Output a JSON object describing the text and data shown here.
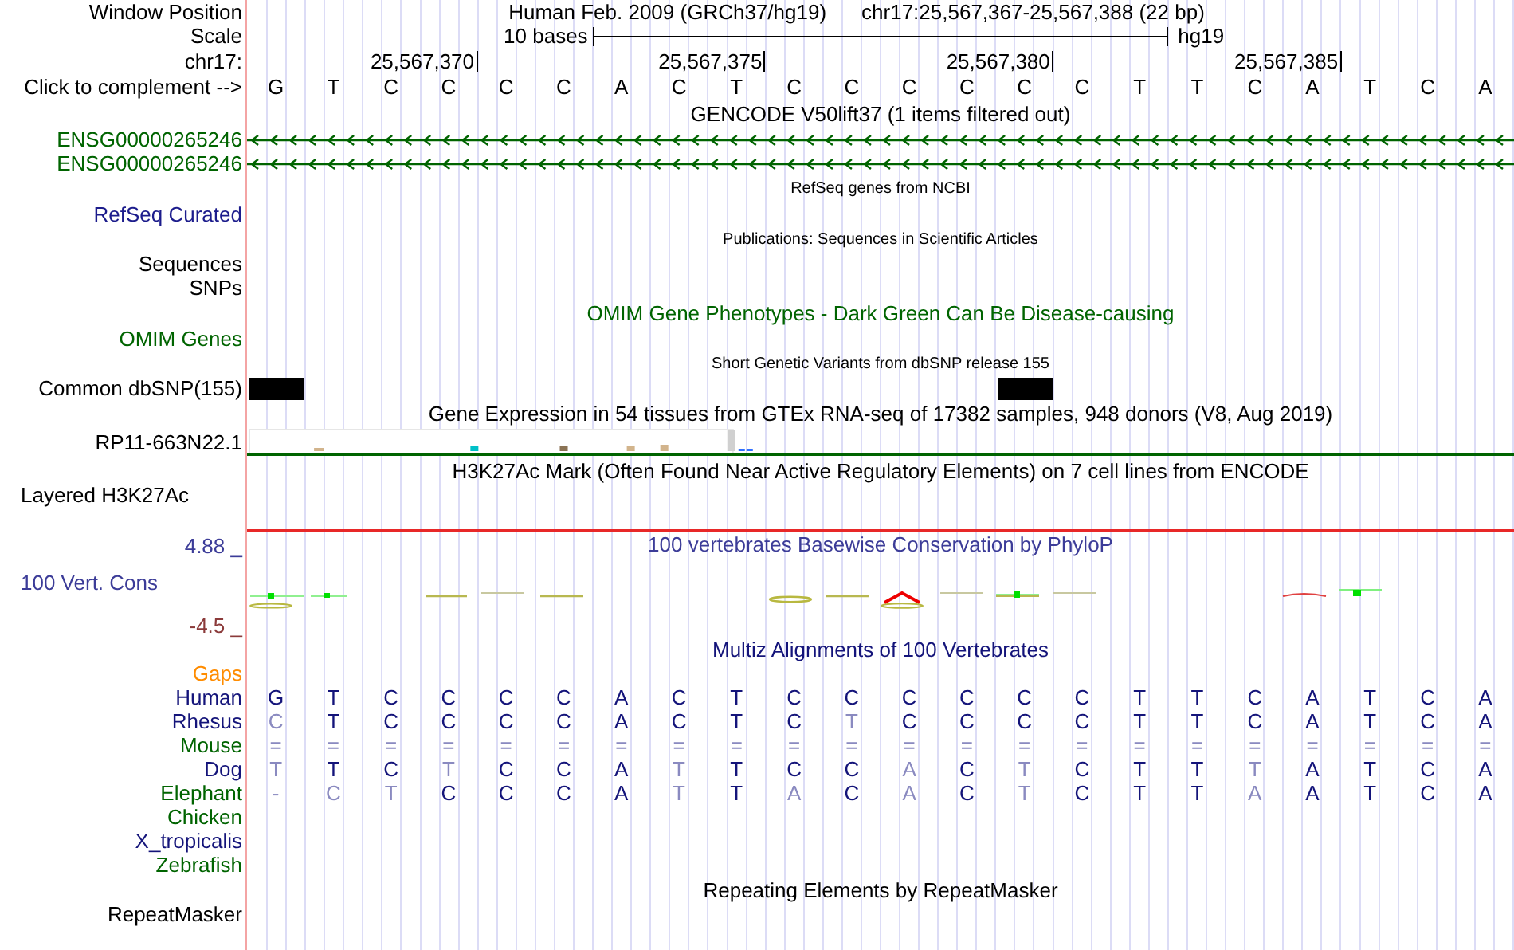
{
  "position": {
    "label": "Window Position",
    "assembly": "Human Feb. 2009 (GRCh37/hg19)",
    "range": "chr17:25,567,367-25,567,388 (22 bp)"
  },
  "scale": {
    "label": "Scale",
    "bar_label": "10 bases",
    "assembly": "hg19"
  },
  "ruler": {
    "label": "chr17:",
    "ticks": [
      "25,567,370",
      "25,567,375",
      "25,567,380",
      "25,567,385"
    ]
  },
  "sequence": {
    "label": "Click to complement -->",
    "bases": [
      "G",
      "T",
      "C",
      "C",
      "C",
      "C",
      "A",
      "C",
      "T",
      "C",
      "C",
      "C",
      "C",
      "C",
      "C",
      "T",
      "T",
      "C",
      "A",
      "T",
      "C",
      "A"
    ]
  },
  "tracks": [
    {
      "kind": "title",
      "text": "GENCODE V50lift37 (1 items filtered out)",
      "color": "#000000"
    },
    {
      "kind": "gene",
      "label": "ENSG00000265246",
      "color": "#006400"
    },
    {
      "kind": "gene",
      "label": "ENSG00000265246",
      "color": "#006400"
    },
    {
      "kind": "small_title",
      "text": "RefSeq genes from NCBI",
      "color": "#000000"
    },
    {
      "kind": "label",
      "label": "RefSeq Curated",
      "color": "#1c1c8c"
    },
    {
      "kind": "small_title",
      "text": "Publications: Sequences in Scientific Articles",
      "color": "#000000"
    },
    {
      "kind": "label",
      "label": "Sequences",
      "color": "#000000"
    },
    {
      "kind": "label",
      "label": "SNPs",
      "color": "#000000"
    },
    {
      "kind": "title",
      "text": "OMIM Gene Phenotypes - Dark Green Can Be Disease-causing",
      "color": "#006400"
    },
    {
      "kind": "label",
      "label": "OMIM Genes",
      "color": "#006400"
    },
    {
      "kind": "small_title",
      "text": "Short Genetic Variants from dbSNP release 155",
      "color": "#000000"
    },
    {
      "kind": "snp",
      "label": "Common dbSNP(155)",
      "color": "#000000",
      "variants": [
        true,
        false,
        false,
        false,
        false,
        false,
        false,
        false,
        false,
        false,
        false,
        false,
        false,
        true,
        false,
        false,
        false,
        false,
        false,
        false,
        false,
        false
      ]
    },
    {
      "kind": "title",
      "text": "Gene Expression in 54 tissues from GTEx RNA-seq of 17382 samples, 948 donors (V8, Aug 2019)",
      "color": "#000000"
    },
    {
      "kind": "expression",
      "label": "RP11-663N22.1",
      "color": "#000000"
    },
    {
      "kind": "title",
      "text": "H3K27Ac Mark (Often Found Near Active Regulatory Elements) on 7 cell lines from ENCODE",
      "color": "#000000"
    },
    {
      "kind": "signal",
      "label": "Layered H3K27Ac",
      "color": "#000000"
    },
    {
      "kind": "conservation",
      "text": "100 vertebrates Basewise Conservation by PhyloP",
      "label": "100 Vert. Cons",
      "max": "4.88 _",
      "min": "-4.5 _",
      "color": "#3c3c98"
    },
    {
      "kind": "title",
      "text": "Multiz Alignments of 100 Vertebrates",
      "color": "#14147a"
    },
    {
      "kind": "label",
      "label": "Gaps",
      "color": "#ff8c00"
    },
    {
      "kind": "alignment",
      "label": "Human",
      "color": "#14147a",
      "bases": [
        {
          "base": "G",
          "faded": false
        },
        {
          "base": "T",
          "faded": false
        },
        {
          "base": "C",
          "faded": false
        },
        {
          "base": "C",
          "faded": false
        },
        {
          "base": "C",
          "faded": false
        },
        {
          "base": "C",
          "faded": false
        },
        {
          "base": "A",
          "faded": false
        },
        {
          "base": "C",
          "faded": false
        },
        {
          "base": "T",
          "faded": false
        },
        {
          "base": "C",
          "faded": false
        },
        {
          "base": "C",
          "faded": false
        },
        {
          "base": "C",
          "faded": false
        },
        {
          "base": "C",
          "faded": false
        },
        {
          "base": "C",
          "faded": false
        },
        {
          "base": "C",
          "faded": false
        },
        {
          "base": "T",
          "faded": false
        },
        {
          "base": "T",
          "faded": false
        },
        {
          "base": "C",
          "faded": false
        },
        {
          "base": "A",
          "faded": false
        },
        {
          "base": "T",
          "faded": false
        },
        {
          "base": "C",
          "faded": false
        },
        {
          "base": "A",
          "faded": false
        }
      ]
    },
    {
      "kind": "alignment",
      "label": "Rhesus",
      "color": "#14147a",
      "bases": [
        {
          "base": "C",
          "faded": true
        },
        {
          "base": "T",
          "faded": false
        },
        {
          "base": "C",
          "faded": false
        },
        {
          "base": "C",
          "faded": false
        },
        {
          "base": "C",
          "faded": false
        },
        {
          "base": "C",
          "faded": false
        },
        {
          "base": "A",
          "faded": false
        },
        {
          "base": "C",
          "faded": false
        },
        {
          "base": "T",
          "faded": false
        },
        {
          "base": "C",
          "faded": false
        },
        {
          "base": "T",
          "faded": true
        },
        {
          "base": "C",
          "faded": false
        },
        {
          "base": "C",
          "faded": false
        },
        {
          "base": "C",
          "faded": false
        },
        {
          "base": "C",
          "faded": false
        },
        {
          "base": "T",
          "faded": false
        },
        {
          "base": "T",
          "faded": false
        },
        {
          "base": "C",
          "faded": false
        },
        {
          "base": "A",
          "faded": false
        },
        {
          "base": "T",
          "faded": false
        },
        {
          "base": "C",
          "faded": false
        },
        {
          "base": "A",
          "faded": false
        }
      ]
    },
    {
      "kind": "alignment",
      "label": "Mouse",
      "color": "#006400",
      "bases": [
        {
          "base": "=",
          "faded": true
        },
        {
          "base": "=",
          "faded": true
        },
        {
          "base": "=",
          "faded": true
        },
        {
          "base": "=",
          "faded": true
        },
        {
          "base": "=",
          "faded": true
        },
        {
          "base": "=",
          "faded": true
        },
        {
          "base": "=",
          "faded": true
        },
        {
          "base": "=",
          "faded": true
        },
        {
          "base": "=",
          "faded": true
        },
        {
          "base": "=",
          "faded": true
        },
        {
          "base": "=",
          "faded": true
        },
        {
          "base": "=",
          "faded": true
        },
        {
          "base": "=",
          "faded": true
        },
        {
          "base": "=",
          "faded": true
        },
        {
          "base": "=",
          "faded": true
        },
        {
          "base": "=",
          "faded": true
        },
        {
          "base": "=",
          "faded": true
        },
        {
          "base": "=",
          "faded": true
        },
        {
          "base": "=",
          "faded": true
        },
        {
          "base": "=",
          "faded": true
        },
        {
          "base": "=",
          "faded": true
        },
        {
          "base": "=",
          "faded": true
        }
      ]
    },
    {
      "kind": "alignment",
      "label": "Dog",
      "color": "#14147a",
      "bases": [
        {
          "base": "T",
          "faded": true
        },
        {
          "base": "T",
          "faded": false
        },
        {
          "base": "C",
          "faded": false
        },
        {
          "base": "T",
          "faded": true
        },
        {
          "base": "C",
          "faded": false
        },
        {
          "base": "C",
          "faded": false
        },
        {
          "base": "A",
          "faded": false
        },
        {
          "base": "T",
          "faded": true
        },
        {
          "base": "T",
          "faded": false
        },
        {
          "base": "C",
          "faded": false
        },
        {
          "base": "C",
          "faded": false
        },
        {
          "base": "A",
          "faded": true
        },
        {
          "base": "C",
          "faded": false
        },
        {
          "base": "T",
          "faded": true
        },
        {
          "base": "C",
          "faded": false
        },
        {
          "base": "T",
          "faded": false
        },
        {
          "base": "T",
          "faded": false
        },
        {
          "base": "T",
          "faded": true
        },
        {
          "base": "A",
          "faded": false
        },
        {
          "base": "T",
          "faded": false
        },
        {
          "base": "C",
          "faded": false
        },
        {
          "base": "A",
          "faded": false
        }
      ]
    },
    {
      "kind": "alignment",
      "label": "Elephant",
      "color": "#006400",
      "bases": [
        {
          "base": "-",
          "faded": true
        },
        {
          "base": "C",
          "faded": true
        },
        {
          "base": "T",
          "faded": true
        },
        {
          "base": "C",
          "faded": false
        },
        {
          "base": "C",
          "faded": false
        },
        {
          "base": "C",
          "faded": false
        },
        {
          "base": "A",
          "faded": false
        },
        {
          "base": "T",
          "faded": true
        },
        {
          "base": "T",
          "faded": false
        },
        {
          "base": "A",
          "faded": true
        },
        {
          "base": "C",
          "faded": false
        },
        {
          "base": "A",
          "faded": true
        },
        {
          "base": "C",
          "faded": false
        },
        {
          "base": "T",
          "faded": true
        },
        {
          "base": "C",
          "faded": false
        },
        {
          "base": "T",
          "faded": false
        },
        {
          "base": "T",
          "faded": false
        },
        {
          "base": "A",
          "faded": true
        },
        {
          "base": "A",
          "faded": false
        },
        {
          "base": "T",
          "faded": false
        },
        {
          "base": "C",
          "faded": false
        },
        {
          "base": "A",
          "faded": false
        }
      ]
    },
    {
      "kind": "label",
      "label": "Chicken",
      "color": "#006400"
    },
    {
      "kind": "label",
      "label": "X_tropicalis",
      "color": "#14147a"
    },
    {
      "kind": "label",
      "label": "Zebrafish",
      "color": "#006400"
    },
    {
      "kind": "title",
      "text": "Repeating Elements by RepeatMasker",
      "color": "#000000"
    },
    {
      "kind": "label",
      "label": "RepeatMasker",
      "color": "#000000"
    }
  ]
}
